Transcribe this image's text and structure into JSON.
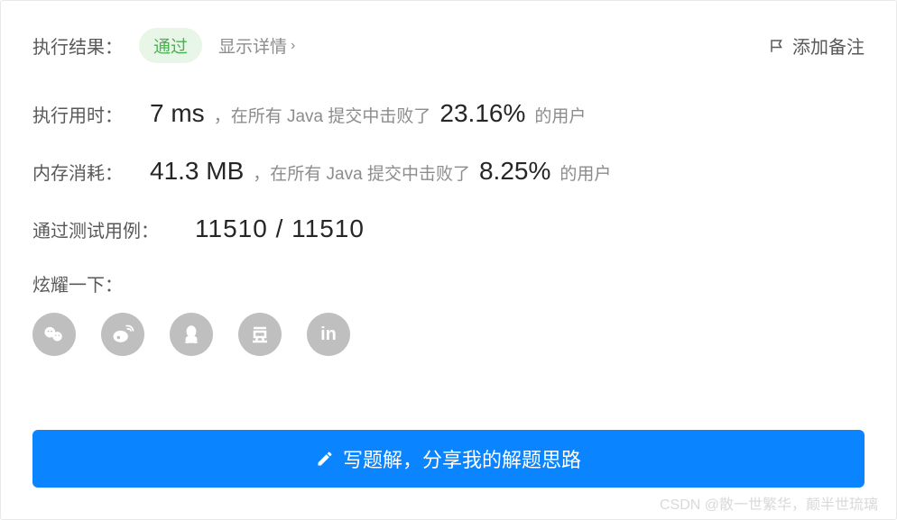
{
  "header": {
    "result_label": "执行结果：",
    "status": "通过",
    "show_details": "显示详情",
    "add_note": "添加备注"
  },
  "runtime": {
    "label": "执行用时：",
    "value": "7 ms",
    "prefix_text": "，在所有 Java 提交中击败了",
    "percent": "23.16%",
    "suffix_text": "的用户"
  },
  "memory": {
    "label": "内存消耗：",
    "value": "41.3 MB",
    "prefix_text": "，在所有 Java 提交中击败了",
    "percent": "8.25%",
    "suffix_text": "的用户"
  },
  "testcases": {
    "label": "通过测试用例：",
    "value": "11510 / 11510"
  },
  "share": {
    "label": "炫耀一下："
  },
  "solution_button": "写题解，分享我的解题思路",
  "watermark": "CSDN @散一世繁华，颠半世琉璃"
}
